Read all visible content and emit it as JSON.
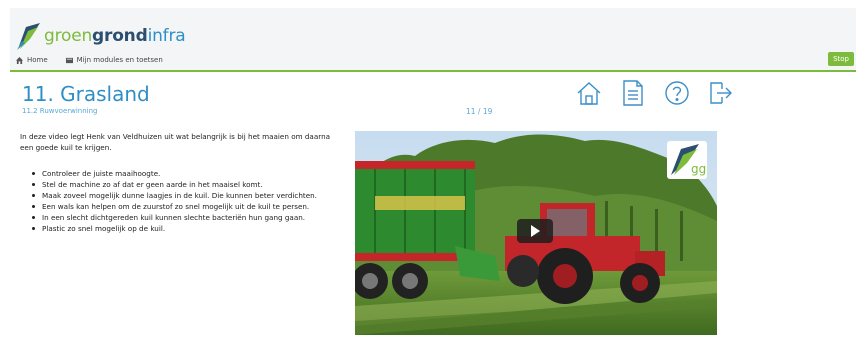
{
  "brand": {
    "part1": "groen",
    "part2": "grond",
    "part3": "infra"
  },
  "nav": {
    "home_label": "Home",
    "modules_label": "Mijn modules en toetsen"
  },
  "stop_label": "Stop",
  "lesson": {
    "title": "11. Grasland",
    "subtitle": "11.2 Ruwvoerwinning",
    "counter": "11 / 19"
  },
  "toolbar": {
    "icons": [
      "home-icon",
      "document-icon",
      "help-icon",
      "exit-icon"
    ]
  },
  "content": {
    "intro": "In deze video legt Henk van Veldhuizen uit wat belangrijk is bij het maaien om daarna een goede kuil te krijgen.",
    "bullets": [
      "Controleer de juiste maaihoogte.",
      "Stel de machine zo af dat er geen aarde in het maaisel komt.",
      "Maak zoveel mogelijk dunne laagjes in de kuil. Die kunnen beter verdichten.",
      "Een wals kan helpen om de zuurstof zo snel mogelijk uit de kuil te persen.",
      "In een slecht dichtgereden kuil kunnen slechte bacteriën hun gang gaan.",
      "Plastic zo snel mogelijk op de kuil."
    ]
  },
  "video": {
    "badge_text": "ggi"
  },
  "colors": {
    "accent_green": "#7dbb3c",
    "accent_blue": "#2e8fc7",
    "icon_blue": "#3d8fc9"
  }
}
